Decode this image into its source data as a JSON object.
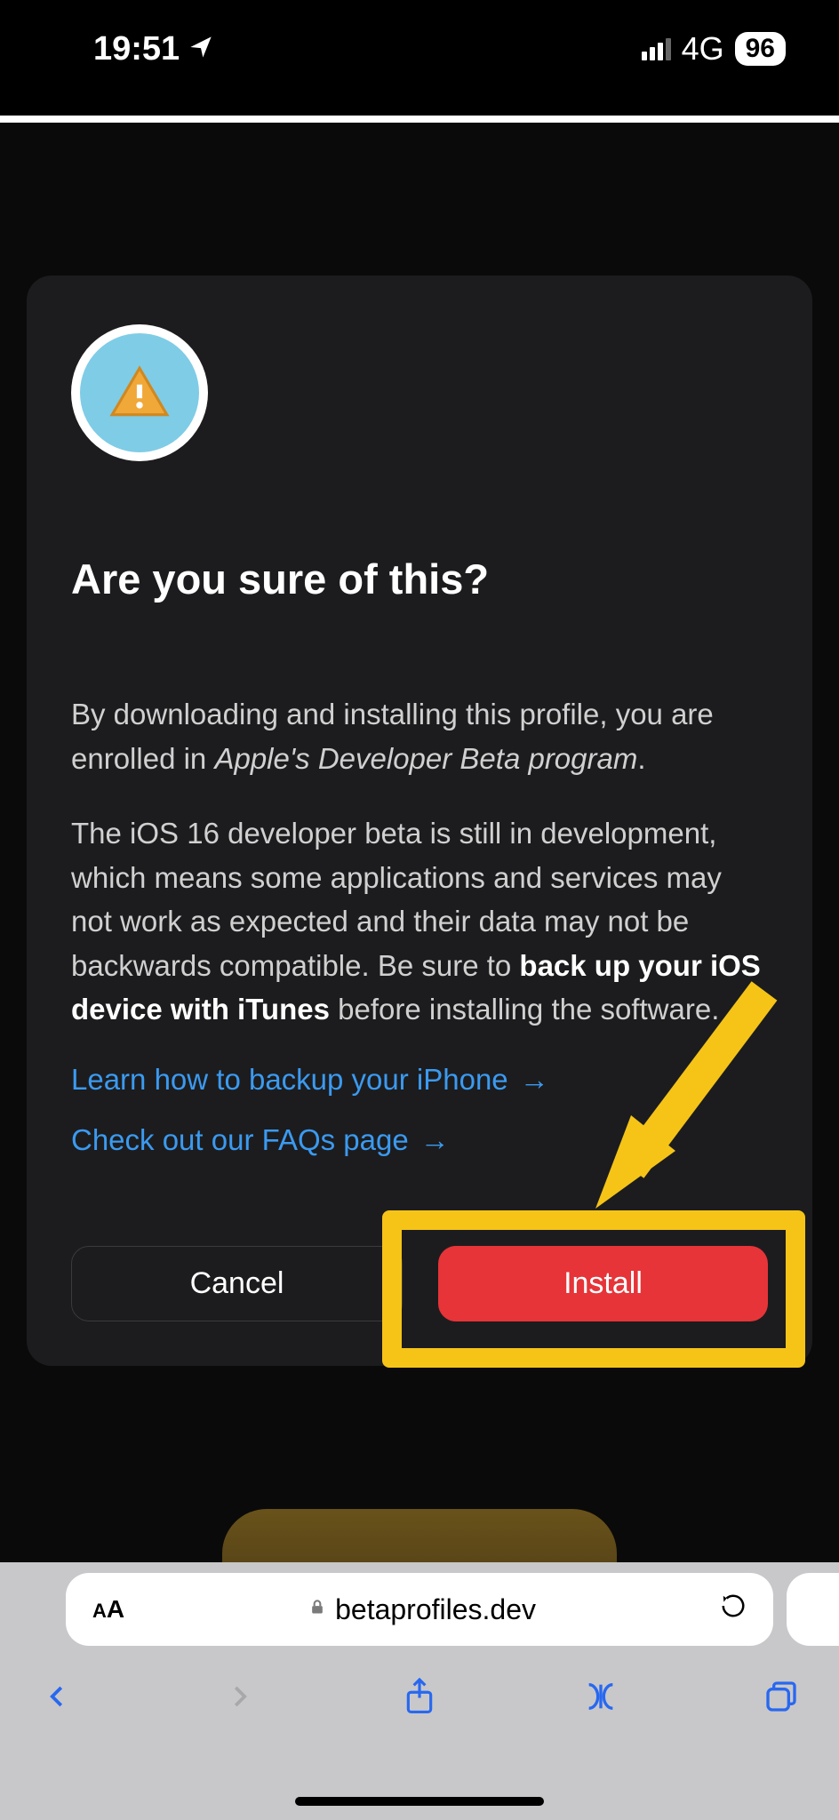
{
  "status": {
    "time": "19:51",
    "network": "4G",
    "battery": "96"
  },
  "dialog": {
    "title": "Are you sure of this?",
    "p1_prefix": "By downloading and installing this profile, you are enrolled in ",
    "p1_italic": "Apple's Developer Beta program",
    "p1_suffix": ".",
    "p2_prefix": "The iOS 16 developer beta is still in development, which means some applications and services may not work as expected and their data may not be backwards compatible. Be sure to ",
    "p2_bold": "back up your iOS device with iTunes",
    "p2_suffix": " before installing the software.",
    "link1": "Learn how to backup your iPhone",
    "link2": "Check out our FAQs page",
    "cancel_label": "Cancel",
    "install_label": "Install"
  },
  "browser": {
    "url": "betaprofiles.dev"
  }
}
